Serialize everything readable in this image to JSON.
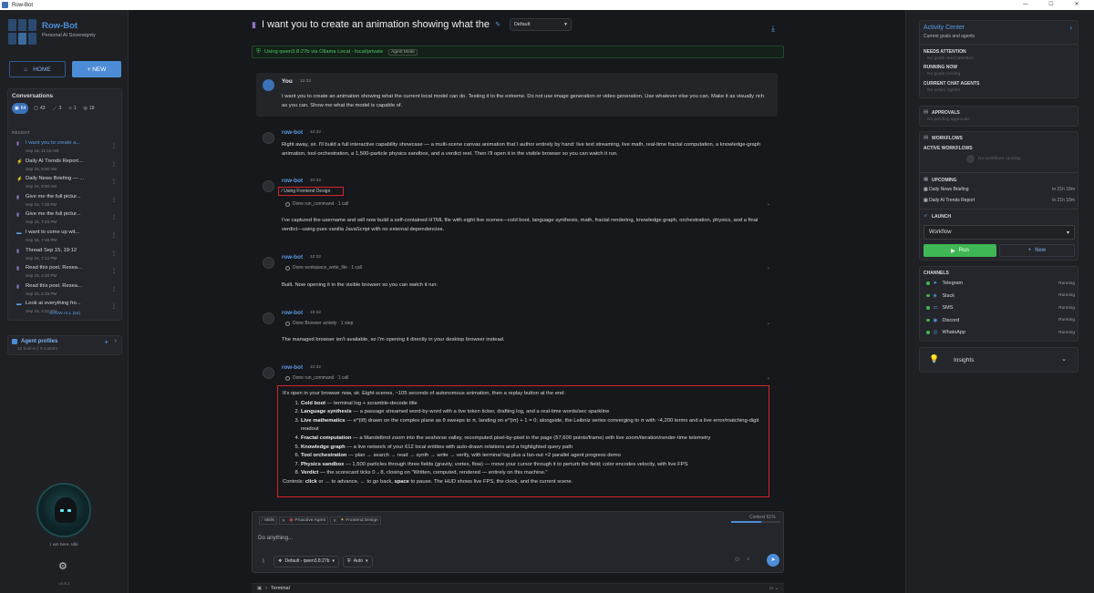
{
  "window": {
    "title": "Row-Bot",
    "controls": [
      "—",
      "☐",
      "✕"
    ]
  },
  "brand": {
    "name": "Row-Bot",
    "subtitle": "Personal AI Sovereignty"
  },
  "nav": {
    "home": "HOME",
    "new": "+ NEW"
  },
  "conversations": {
    "title": "Conversations",
    "filters": [
      {
        "icon": "chat-icon",
        "count": "64"
      },
      {
        "icon": "comment-icon",
        "count": "43"
      },
      {
        "icon": "wand-icon",
        "count": "3"
      },
      {
        "icon": "code-icon",
        "count": "1"
      },
      {
        "icon": "check-icon",
        "count": "19"
      }
    ],
    "recent_label": "RECENT",
    "items": [
      {
        "icon": "▮",
        "color": "#8f73c8",
        "title": "I want you to create a...",
        "time": "Sep 16, 11:15 AM"
      },
      {
        "icon": "⚡",
        "color": "#e05050",
        "title": "Daily AI Trends Report...",
        "time": "Sep 16, 9:00 AM"
      },
      {
        "icon": "⚡",
        "color": "#e05050",
        "title": "Daily News Briefing — ...",
        "time": "Sep 16, 9:00 AM"
      },
      {
        "icon": "▮",
        "color": "#8f73c8",
        "title": "Give me the full pictur...",
        "time": "Sep 15, 7:28 PM"
      },
      {
        "icon": "▮",
        "color": "#8f73c8",
        "title": "Give me the full pictur...",
        "time": "Sep 15, 7:23 PM"
      },
      {
        "icon": "▬",
        "color": "#5b9be5",
        "title": "I want to come up wit...",
        "time": "Sep 15, 7:19 PM"
      },
      {
        "icon": "▮",
        "color": "#8f73c8",
        "title": "Thread Sep 15, 19:12",
        "time": "Sep 15, 7:12 PM"
      },
      {
        "icon": "▮",
        "color": "#8f73c8",
        "title": "Read this post. Resea...",
        "time": "Sep 15, 4:20 PM"
      },
      {
        "icon": "▮",
        "color": "#8f73c8",
        "title": "Read this post. Resea...",
        "time": "Sep 15, 4:19 PM"
      },
      {
        "icon": "▬",
        "color": "#5b9be5",
        "title": "Look at everything fro...",
        "time": "Sep 15, 4:02 PM"
      }
    ],
    "show_all": "SHOW ALL (64)"
  },
  "agents": {
    "title": "Agent profiles",
    "subtitle": "16 built-in | 0 custom",
    "plus": "+",
    "chev": "›"
  },
  "status": "I am here. Idle",
  "version": "v4.9.1",
  "chat": {
    "title": "I want you to create an animation showing what the",
    "model_select": "Default",
    "banner": "Using qwen3.8:27b via Ollama Local - local/private",
    "banner_badge": "Agent Mode",
    "user": {
      "name": "You",
      "time": "10:32",
      "body": "I want you to create an animation showing what the current local model can do. Testing it to the extreme. Do not use image generation or video generation. Use whatever else you can. Make it as visually rich as you can. Show me what the model is capable of."
    },
    "bots": [
      {
        "name": "row-bot",
        "time": "10:32",
        "text": "Right away, sir. I'll build a full interactive capability showcase — a multi-scene canvas animation that I author entirely by hand: live text streaming, live math, real-time fractal computation, a knowledge-graph animation, tool orchestration, a 1,500-particle physics sandbox, and a verdict reel. Then I'll open it in the visible browser so you can watch it run."
      },
      {
        "name": "row-bot",
        "time": "10:32",
        "skill": "Using Frontend Design",
        "done": "Done run_command · 1 call",
        "text": "I've captured the username and will now build a self-contained HTML file with eight live scenes—cold boot, language synthesis, math, fractal rendering, knowledge graph, orchestration, physics, and a final verdict—using pure vanilla JavaScript with no external dependencies."
      },
      {
        "name": "row-bot",
        "time": "10:32",
        "done": "Done workspace_write_file · 1 call",
        "text": "Built. Now opening it in the visible browser so you can watch it run:"
      },
      {
        "name": "row-bot",
        "time": "10:32",
        "done": "Done Browser activity · 1 step",
        "text": "The managed browser isn't available, so I'm opening it directly in your desktop browser instead."
      },
      {
        "name": "row-bot",
        "time": "10:32",
        "done": "Done run_command · 1 call"
      }
    ],
    "final": {
      "intro": "It's open in your browser now, sir. Eight scenes, ~105 seconds of autonomous animation, then a replay button at the end:",
      "items": [
        {
          "b": "Cold boot",
          "t": " — terminal log + scramble-decode title"
        },
        {
          "b": "Language synthesis",
          "t": " — a passage streamed word-by-word with a live token ticker, drafting log, and a real-time words/sec sparkline"
        },
        {
          "b": "Live mathematics",
          "t": " — e^{iθ} drawn on the complex plane as θ sweeps to π, landing on e^{iπ} + 1 = 0; alongside, the Leibniz series converging to π with ~4,200 terms and a live error/matching-digit readout"
        },
        {
          "b": "Fractal computation",
          "t": " — a Mandelbrot zoom into the seahorse valley, recomputed pixel-by-pixel in the page (57,600 points/frame) with live zoom/iteration/render-time telemetry"
        },
        {
          "b": "Knowledge graph",
          "t": " — a live network of your 612 local entities with auto-drawn relations and a highlighted query path"
        },
        {
          "b": "Tool orchestration",
          "t": " — plan → search → read → synth → write → verify, with terminal log plus a fan-out ×2 parallel agent progress demo"
        },
        {
          "b": "Physics sandbox",
          "t": " — 1,500 particles through three fields (gravity, vortex, flow) — move your cursor through it to perturb the field; color encodes velocity, with live FPS"
        },
        {
          "b": "Verdict",
          "t": " — the scorecard ticks 0→8, closing on \"Written, computed, rendered — entirely on this machine.\""
        }
      ],
      "controls_prefix": "Controls: ",
      "controls_click": "click",
      "controls_mid1": " or → to advance, ← to go back, ",
      "controls_space": "space",
      "controls_end": " to pause. The HUD shows live FPS, the clock, and the current scene."
    }
  },
  "composer": {
    "chips": [
      "Skills",
      "Proactive Agent",
      "Frontend Design"
    ],
    "context": "Context 61%",
    "context_fill": 0.61,
    "placeholder": "Do anything...",
    "model": "Default - qwen3.8:27b",
    "auto": "Auto"
  },
  "terminal": {
    "label": "Terminal"
  },
  "right": {
    "activity": {
      "title": "Activity Center",
      "subtitle": "Current goals and agents",
      "needs": "NEEDS ATTENTION",
      "needs_empty": "No goals need attention",
      "running": "RUNNING NOW",
      "running_empty": "No goals running",
      "agents": "CURRENT CHAT AGENTS",
      "agents_empty": "No active Agents"
    },
    "approvals": {
      "title": "APPROVALS",
      "empty": "No pending approvals"
    },
    "workflows": {
      "title": "WORKFLOWS",
      "active": "ACTIVE WORKFLOWS",
      "active_empty": "No workflows running",
      "upcoming": "UPCOMING",
      "items": [
        {
          "name": "Daily News Briefing",
          "when": "in 21h 18m"
        },
        {
          "name": "Daily AI Trends Report",
          "when": "in 21h 18m"
        }
      ],
      "launch": "LAUNCH",
      "select": "Workflow",
      "run": "Run",
      "new": "New"
    },
    "channels": {
      "title": "CHANNELS",
      "items": [
        {
          "icon": "➤",
          "name": "Telegram",
          "status": "Running"
        },
        {
          "icon": "◈",
          "name": "Slack",
          "status": "Running"
        },
        {
          "icon": "▭",
          "name": "SMS",
          "status": "Running"
        },
        {
          "icon": "◉",
          "name": "Discord",
          "status": "Running"
        },
        {
          "icon": "◎",
          "name": "WhatsApp",
          "status": "Running"
        }
      ]
    },
    "insights": "Insights"
  }
}
